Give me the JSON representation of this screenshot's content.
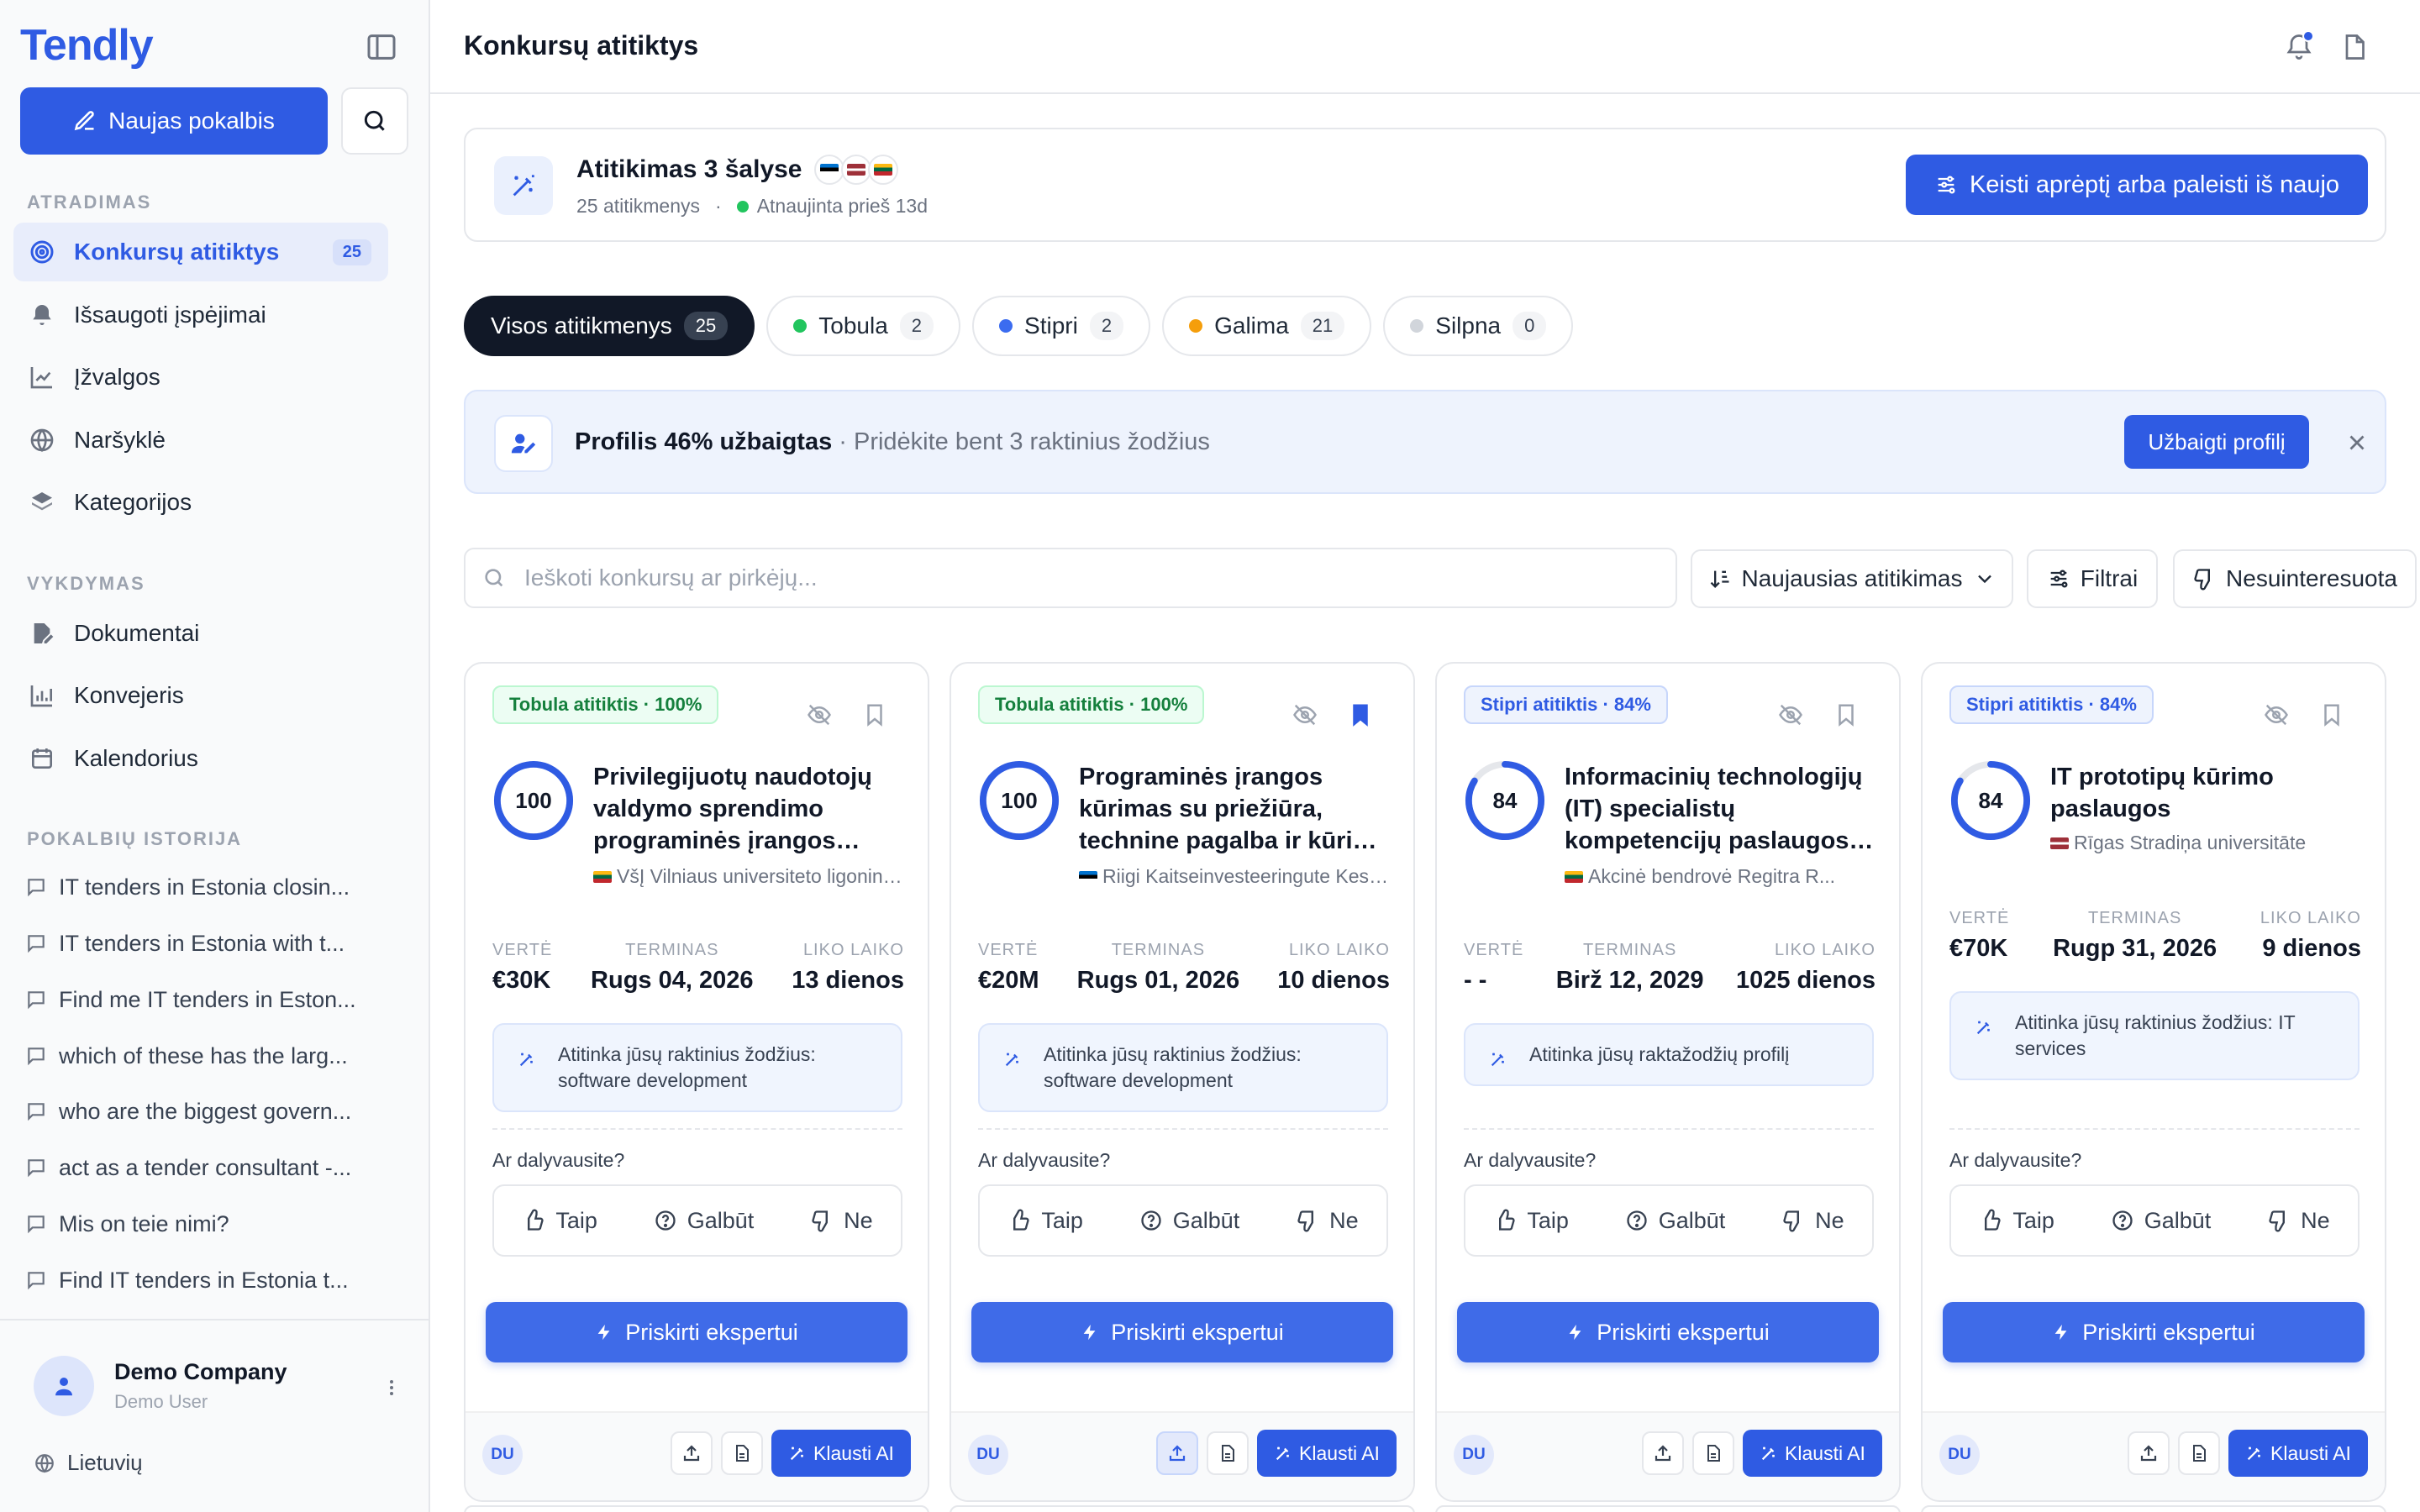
{
  "app": {
    "name": "Tendly"
  },
  "sidebar": {
    "new_chat": "Naujas pokalbis",
    "sections": {
      "discovery": "ATRADIMAS",
      "execution": "VYKDYMAS",
      "history": "POKALBIŲ ISTORIJA"
    },
    "discovery": [
      {
        "label": "Konkursų atitiktys",
        "badge": "25"
      },
      {
        "label": "Išsaugoti įspėjimai"
      },
      {
        "label": "Įžvalgos"
      },
      {
        "label": "Naršyklė"
      },
      {
        "label": "Kategorijos"
      }
    ],
    "execution": [
      {
        "label": "Dokumentai"
      },
      {
        "label": "Konvejeris"
      },
      {
        "label": "Kalendorius"
      }
    ],
    "history": [
      "IT tenders in Estonia closin...",
      "IT tenders in Estonia with t...",
      "Find me IT tenders in Eston...",
      "which of these has the larg...",
      "who are the biggest govern...",
      "act as a tender consultant -...",
      "Mis on teie nimi?",
      "Find IT tenders in Estonia t..."
    ],
    "user": {
      "company": "Demo Company",
      "role": "Demo User"
    },
    "language": "Lietuvių"
  },
  "header": {
    "title": "Konkursų atitiktys"
  },
  "scope": {
    "title": "Atitikimas 3 šalyse",
    "count": "25 atitikmenys",
    "updated": "Atnaujinta prieš 13d",
    "button": "Keisti aprėptį arba paleisti iš naujo"
  },
  "tabs": [
    {
      "label": "Visos atitikmenys",
      "count": "25"
    },
    {
      "label": "Tobula",
      "count": "2"
    },
    {
      "label": "Stipri",
      "count": "2"
    },
    {
      "label": "Galima",
      "count": "21"
    },
    {
      "label": "Silpna",
      "count": "0"
    }
  ],
  "profile": {
    "bold": "Profilis 46% užbaigtas",
    "rest": " · Pridėkite bent 3 raktinius žodžius",
    "button": "Užbaigti profilį"
  },
  "toolbar": {
    "search_placeholder": "Ieškoti konkursų ar pirkėjų...",
    "sort": "Naujausias atitikimas",
    "filters": "Filtrai",
    "not_interested": "Nesuinteresuota"
  },
  "card_labels": {
    "value": "VERTĖ",
    "deadline": "TERMINAS",
    "remaining": "LIKO LAIKO",
    "question": "Ar dalyvausite?",
    "yes": "Taip",
    "maybe": "Galbūt",
    "no": "Ne",
    "assign": "Priskirti ekspertui",
    "initials": "DU",
    "ask_ai": "Klausti AI"
  },
  "cards": [
    {
      "badge": "Tobula atitiktis · 100%",
      "score": "100",
      "score_pct": 100,
      "title": "Privilegijuotų naudotojų valdymo sprendimo programinės įrangos įsigijimas",
      "buyer": "VšĮ Vilniaus universiteto ligoninės Santaros klinikos",
      "value": "€30K",
      "deadline": "Rugs 04, 2026",
      "remaining": "13 dienos",
      "keywords": "Atitinka jūsų raktinius žodžius: software development"
    },
    {
      "badge": "Tobula atitiktis · 100%",
      "score": "100",
      "score_pct": 100,
      "title": "Programinės įrangos kūrimas su priežiūra, technine pagalba ir kūrimo paslaugomis",
      "buyer": "Riigi Kaitseinvesteeringute Keskus",
      "value": "€20M",
      "deadline": "Rugs 01, 2026",
      "remaining": "10 dienos",
      "keywords": "Atitinka jūsų raktinius žodžius: software development"
    },
    {
      "badge": "Stipri atitiktis · 84%",
      "score": "84",
      "score_pct": 84,
      "title": "Informacinių technologijų (IT) specialistų kompetencijų paslaugos pirkimas",
      "buyer": "Akcinė bendrovė Regitra  R...",
      "value": "- -",
      "deadline": "Birž 12, 2029",
      "remaining": "1025 dienos",
      "keywords": "Atitinka jūsų raktažodžių profilį"
    },
    {
      "badge": "Stipri atitiktis · 84%",
      "score": "84",
      "score_pct": 84,
      "title": "IT prototipų kūrimo paslaugos",
      "buyer": "Rīgas Stradiņa universitāte",
      "value": "€70K",
      "deadline": "Rugp 31, 2026",
      "remaining": "9 dienos",
      "keywords": "Atitinka jūsų raktinius žodžius: IT services"
    }
  ],
  "colors": {
    "accent": "#2f5be3",
    "perfect": "#22c55e",
    "strong": "#3b6cf0",
    "possible": "#f59e0b",
    "weak": "#d1d5db"
  }
}
